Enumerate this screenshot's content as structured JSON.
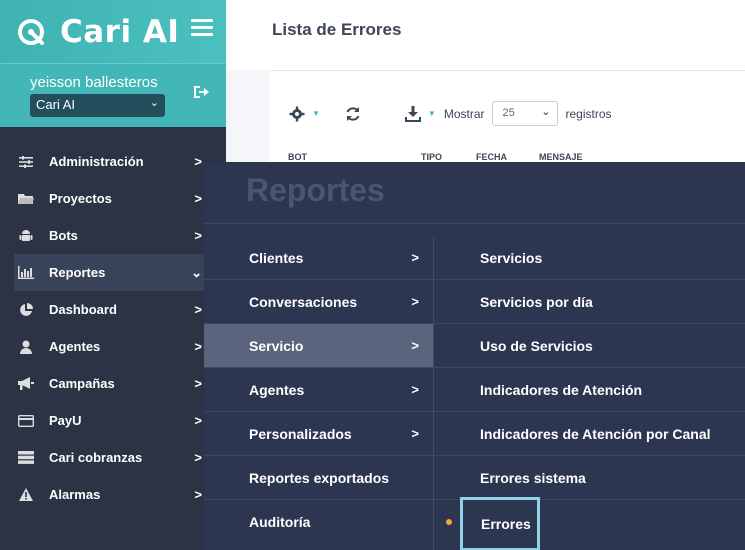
{
  "brand": {
    "name": "Cari AI"
  },
  "user": {
    "name": "yeisson ballesteros",
    "selected_org": "Cari AI"
  },
  "sidebar": {
    "items": [
      {
        "label": "Administración",
        "icon": "sliders-icon"
      },
      {
        "label": "Proyectos",
        "icon": "folder-icon"
      },
      {
        "label": "Bots",
        "icon": "android-icon"
      },
      {
        "label": "Reportes",
        "icon": "bar-chart-icon"
      },
      {
        "label": "Dashboard",
        "icon": "pie-chart-icon"
      },
      {
        "label": "Agentes",
        "icon": "user-icon"
      },
      {
        "label": "Campañas",
        "icon": "megaphone-icon"
      },
      {
        "label": "PayU",
        "icon": "credit-card-icon"
      },
      {
        "label": "Cari cobranzas",
        "icon": "server-icon"
      },
      {
        "label": "Alarmas",
        "icon": "warning-icon"
      }
    ]
  },
  "page": {
    "title": "Lista de Errores",
    "show_label": "Mostrar",
    "page_size": "25",
    "records_label": "registros",
    "columns": [
      "BOT",
      "TIPO",
      "FECHA",
      "MENSAJE"
    ]
  },
  "mega": {
    "title": "Reportes",
    "left": [
      {
        "label": "Clientes",
        "arrow": ">"
      },
      {
        "label": "Conversaciones",
        "arrow": ">"
      },
      {
        "label": "Servicio",
        "arrow": ">"
      },
      {
        "label": "Agentes",
        "arrow": ">"
      },
      {
        "label": "Personalizados",
        "arrow": ">"
      },
      {
        "label": "Reportes exportados"
      },
      {
        "label": "Auditoría"
      }
    ],
    "right": [
      {
        "label": "Servicios"
      },
      {
        "label": "Servicios por día"
      },
      {
        "label": "Uso de Servicios"
      },
      {
        "label": "Indicadores de Atención"
      },
      {
        "label": "Indicadores de Atención por Canal"
      },
      {
        "label": "Errores sistema"
      },
      {
        "label": "Errores"
      }
    ]
  },
  "colors": {
    "accent": "#43b7b7",
    "sidebar": "#2b3345",
    "mega": "#2c3651",
    "highlight": "#8fd2e5",
    "dot": "#f1a33c"
  }
}
